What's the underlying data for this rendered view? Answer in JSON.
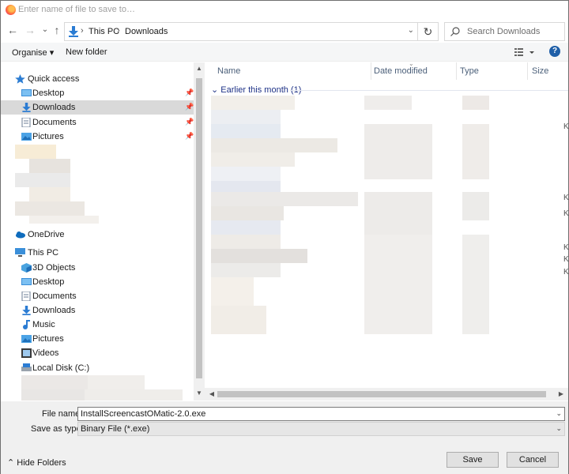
{
  "title": {
    "placeholder": "Enter name of file to save to…"
  },
  "nav": {
    "back": "←",
    "forward": "→",
    "recent": "⌄",
    "up": "↑"
  },
  "breadcrumb": {
    "items": [
      "This PC",
      "Downloads"
    ],
    "sep": "›",
    "dropdown": "⌄"
  },
  "refresh": "↻",
  "search": {
    "placeholder": "Search Downloads"
  },
  "toolbar": {
    "organise": "Organise ▾",
    "new_folder": "New folder",
    "help": "?"
  },
  "sidebar": {
    "quick_access": "Quick access",
    "quick_items": [
      "Desktop",
      "Downloads",
      "Documents",
      "Pictures"
    ],
    "onedrive": "OneDrive",
    "this_pc": "This PC",
    "pc_items": [
      "3D Objects",
      "Desktop",
      "Documents",
      "Downloads",
      "Music",
      "Pictures",
      "Videos",
      "Local Disk (C:)"
    ]
  },
  "columns": {
    "name": "Name",
    "date": "Date modified",
    "type": "Type",
    "size": "Size"
  },
  "group": {
    "label": "Earlier this month (1)"
  },
  "size_letters": [
    "K",
    "K",
    "K",
    "K",
    "K",
    "K"
  ],
  "form": {
    "file_name_label": "File name:",
    "file_name_value": "InstallScreencastOMatic-2.0.exe",
    "save_type_label": "Save as type:",
    "save_type_value": "Binary File (*.exe)"
  },
  "footer": {
    "hide_folders": "Hide Folders",
    "save": "Save",
    "cancel": "Cancel"
  },
  "colors": {
    "accent": "#1e3287",
    "folder": "#e8b339",
    "selected": "#d9d9d9"
  }
}
